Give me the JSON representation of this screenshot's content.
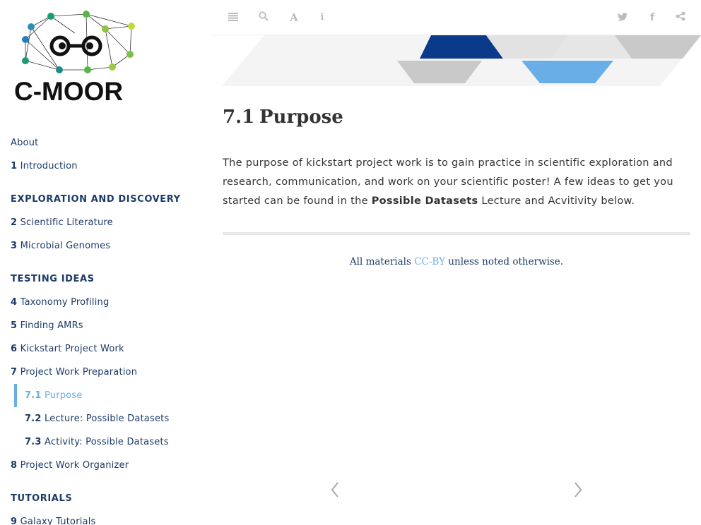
{
  "logo": {
    "text": "C-MOOR"
  },
  "toolbar": {
    "icons": [
      "toc-toggle-icon",
      "search-icon",
      "font-settings-icon",
      "info-icon",
      "twitter-icon",
      "facebook-icon",
      "share-icon"
    ]
  },
  "sidebar": {
    "about": "About",
    "intro": {
      "num": "1",
      "label": "Introduction"
    },
    "section1_header": "EXPLORATION AND DISCOVERY",
    "ch2": {
      "num": "2",
      "label": "Scientific Literature"
    },
    "ch3": {
      "num": "3",
      "label": "Microbial Genomes"
    },
    "section2_header": "TESTING IDEAS",
    "ch4": {
      "num": "4",
      "label": "Taxonomy Profiling"
    },
    "ch5": {
      "num": "5",
      "label": "Finding AMRs"
    },
    "ch6": {
      "num": "6",
      "label": "Kickstart Project Work"
    },
    "ch7": {
      "num": "7",
      "label": "Project Work Preparation"
    },
    "s71": {
      "num": "7.1",
      "label": "Purpose"
    },
    "s72": {
      "num": "7.2",
      "label": "Lecture: Possible Datasets"
    },
    "s73": {
      "num": "7.3",
      "label": "Activity: Possible Datasets"
    },
    "ch8": {
      "num": "8",
      "label": "Project Work Organizer"
    },
    "section3_header": "TUTORIALS",
    "ch9": {
      "num": "9",
      "label": "Galaxy Tutorials"
    }
  },
  "main": {
    "section_num": "7.1",
    "section_title": "Purpose",
    "para_before": "The purpose of kickstart project work is to gain practice in scientific exploration and research, communication, and work on your scientific poster! A few ideas to get you started can be found in the ",
    "para_bold": "Possible Datasets",
    "para_after": " Lecture and Acvitivity below.",
    "footer_prefix": "All materials ",
    "footer_link": "CC-BY",
    "footer_suffix": " unless noted otherwise."
  },
  "colors": {
    "accent": "#6aaee8",
    "nav_text": "#1c3b68",
    "banner_dark": "#0b3a8a",
    "banner_light": "#6aaee8"
  }
}
